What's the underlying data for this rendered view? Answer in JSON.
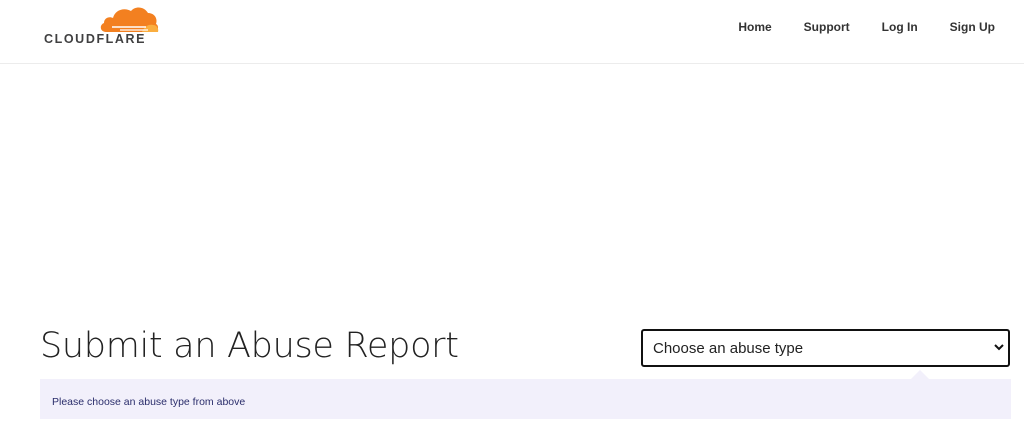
{
  "brand": {
    "name": "CLOUDFLARE",
    "logo_icon": "cloud-icon",
    "colors": {
      "cloud_primary": "#f38020",
      "cloud_secondary": "#faae40",
      "wordmark": "#404041"
    }
  },
  "nav": {
    "items": [
      {
        "label": "Home"
      },
      {
        "label": "Support"
      },
      {
        "label": "Log In"
      },
      {
        "label": "Sign Up"
      }
    ]
  },
  "main": {
    "title": "Submit an Abuse Report",
    "abuse_select": {
      "selected": "Choose an abuse type",
      "options": [
        "Choose an abuse type"
      ]
    },
    "info_message": "Please choose an abuse type from above",
    "colors": {
      "info_bg": "#f2f0fb",
      "info_text": "#2a2d6b"
    }
  }
}
